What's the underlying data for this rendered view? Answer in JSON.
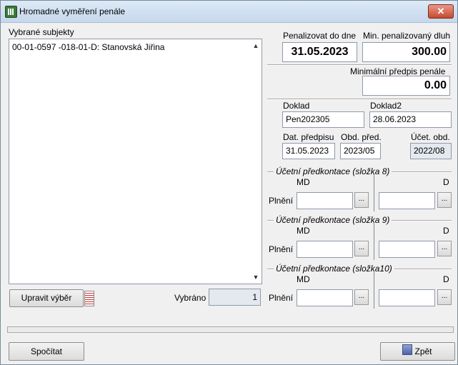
{
  "window": {
    "title": "Hromadné vyměření penále",
    "close_label": "✕",
    "icon": "table-calendar-icon"
  },
  "left": {
    "list_label": "Vybrané subjekty",
    "items": [
      "00-01-0597 -018-01-D: Stanovská Jiřina"
    ],
    "edit_button": "Upravit výběr",
    "selected_label": "Vybráno",
    "selected_count": "1"
  },
  "right": {
    "penalize_to_label": "Penalizovat do dne",
    "penalize_to_value": "31.05.2023",
    "min_debt_label": "Min. penalizovaný dluh",
    "min_debt_value": "300.00",
    "min_charge_label": "Minimální předpis penále",
    "min_charge_value": "0.00",
    "doc_label": "Doklad",
    "doc_value": "Pen202305",
    "doc2_label": "Doklad2",
    "doc2_value": "28.06.2023",
    "charge_date_label": "Dat. předpisu",
    "charge_date_value": "31.05.2023",
    "period_label": "Obd. před.",
    "period_value": "2023/05",
    "acc_period_label": "Účet. obd.",
    "acc_period_value": "2022/08"
  },
  "groups": [
    {
      "title": "Účetní předkontace (složka 8)",
      "md": "MD",
      "d": "D",
      "row_label": "Plnění",
      "md_value": "",
      "d_value": "",
      "ellipsis": "..."
    },
    {
      "title": "Účetní předkontace (složka 9)",
      "md": "MD",
      "d": "D",
      "row_label": "Plnění",
      "md_value": "",
      "d_value": "",
      "ellipsis": "..."
    },
    {
      "title": "Účetní předkontace (složka10)",
      "md": "MD",
      "d": "D",
      "row_label": "Plnění",
      "md_value": "",
      "d_value": "",
      "ellipsis": "..."
    }
  ],
  "footer": {
    "calc_button": "Spočítat",
    "back_button": "Zpět"
  }
}
